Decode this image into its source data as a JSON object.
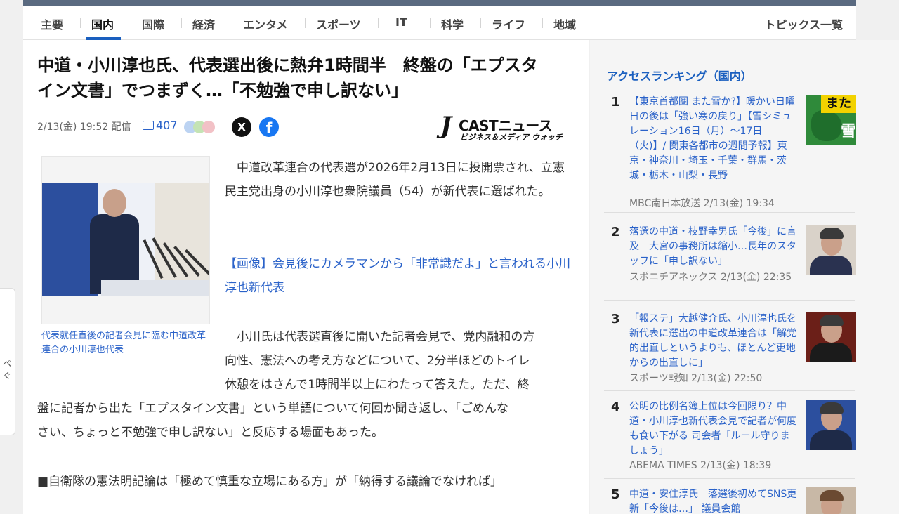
{
  "nav": {
    "items": [
      "主要",
      "国内",
      "国際",
      "経済",
      "エンタメ",
      "スポーツ",
      "IT",
      "科学",
      "ライフ",
      "地域"
    ],
    "active": "国内",
    "topics": "トピックス一覧"
  },
  "article": {
    "headline_line1": "中道・小川淳也氏、代表選出後に熱弁1時間半　終盤の「エプスタ",
    "headline_line2": "イン文書」でつまずく…「不勉強で申し訳ない」",
    "date": "2/13(金) 19:52 配信",
    "comment_count": "407",
    "share_x": "X",
    "share_facebook": "f",
    "source_logo_initial": "J",
    "source_logo_name": "CASTニュース",
    "source_logo_sub": "ビジネス＆メディア ウォッチ",
    "photo_caption": "代表就任直後の記者会見に臨む中道改革連合の小川淳也代表",
    "paragraph1": "　中道改革連合の代表選が2026年2月13日に投開票され、立憲民主党出身の小川淳也衆院議員（54）が新代表に選ばれた。",
    "image_link": "【画像】会見後にカメラマンから「非常識だよ」と言われる小川淳也新代表",
    "paragraph2_lines": [
      "　小川氏は代表選直後に開いた記者会見で、党内融和の方",
      "向性、憲法への考え方などについて、2分半ほどのトイレ",
      "休憩をはさんで1時間半以上にわたって答えた。ただ、終",
      "盤に記者から出た「エプスタイン文書」という単語について何回か聞き返し、「ごめんな",
      "さい、ちょっと不勉強で申し訳ない」と反応する場面もあった。"
    ],
    "section_heading": "■自衛隊の憲法明記論は「極めて慎重な立場にある方」が「納得する議論でなければ」"
  },
  "side_tab_text": "ペぐ",
  "ranking": {
    "title": "アクセスランキング（国内）",
    "items": [
      {
        "rank": "1",
        "title": "【東京首都圏 また雪か?】暖かい日曜日の後は「強い寒の戻り」【雪シミュレーション16日（月）～17日（火)】/ 関東各都市の週間予報】東京・神奈川・埼玉・千葉・群馬・茨城・栃木・山梨・長野",
        "source": "MBC南日本放送 2/13(金) 19:34",
        "thumb_text_1": "また",
        "thumb_text_2": "雪"
      },
      {
        "rank": "2",
        "title": "落選の中道・枝野幸男氏「今後」に言及　大宮の事務所は縮小…長年のスタッフに「申し訳ない」",
        "source": "スポニチアネックス 2/13(金) 22:35"
      },
      {
        "rank": "3",
        "title": "「報ステ」大越健介氏、小川淳也氏を新代表に選出の中道改革連合は「解党的出直しというよりも、ほとんど更地からの出直しに」",
        "source": "スポーツ報知 2/13(金) 22:50"
      },
      {
        "rank": "4",
        "title": "公明の比例名簿上位は今回限り？中道・小川淳也新代表会見で記者が何度も食い下がる 司会者「ルール守りましょう」",
        "source": "ABEMA TIMES 2/13(金) 18:39"
      },
      {
        "rank": "5",
        "title": "中道・安住淳氏　落選後初めてSNS更新「今後は…」 議員会館",
        "source": ""
      }
    ]
  },
  "colors": {
    "accent": "#1a5fbf",
    "link": "#2a62c9",
    "x_brand": "#111111",
    "facebook_brand": "#1877f2"
  }
}
